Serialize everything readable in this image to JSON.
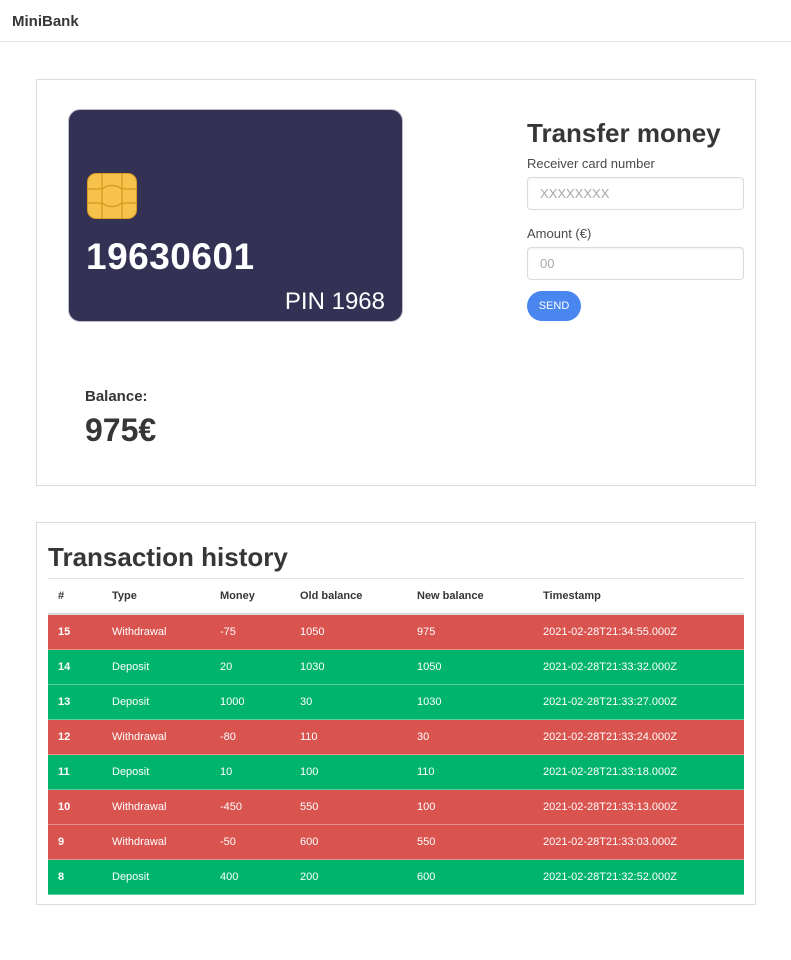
{
  "nav": {
    "brand": "MiniBank"
  },
  "card": {
    "number": "19630601",
    "pin": "PIN 1968",
    "chip_icon": "chip-icon",
    "background": "#333154"
  },
  "balance": {
    "label": "Balance:",
    "value": "975€"
  },
  "transfer": {
    "title": "Transfer money",
    "receiver_label": "Receiver card number",
    "receiver_placeholder": "XXXXXXXX",
    "amount_label": "Amount (€)",
    "amount_placeholder": "00",
    "send_label": "SEND",
    "button_color": "#4a86f0"
  },
  "history": {
    "title": "Transaction history",
    "columns": [
      "#",
      "Type",
      "Money",
      "Old balance",
      "New balance",
      "Timestamp"
    ],
    "colors": {
      "withdrawal": "#d9534f",
      "deposit": "#00b46c"
    },
    "rows": [
      {
        "id": "15",
        "type": "Withdrawal",
        "money": "-75",
        "old_balance": "1050",
        "new_balance": "975",
        "timestamp": "2021-02-28T21:34:55.000Z"
      },
      {
        "id": "14",
        "type": "Deposit",
        "money": "20",
        "old_balance": "1030",
        "new_balance": "1050",
        "timestamp": "2021-02-28T21:33:32.000Z"
      },
      {
        "id": "13",
        "type": "Deposit",
        "money": "1000",
        "old_balance": "30",
        "new_balance": "1030",
        "timestamp": "2021-02-28T21:33:27.000Z"
      },
      {
        "id": "12",
        "type": "Withdrawal",
        "money": "-80",
        "old_balance": "110",
        "new_balance": "30",
        "timestamp": "2021-02-28T21:33:24.000Z"
      },
      {
        "id": "11",
        "type": "Deposit",
        "money": "10",
        "old_balance": "100",
        "new_balance": "110",
        "timestamp": "2021-02-28T21:33:18.000Z"
      },
      {
        "id": "10",
        "type": "Withdrawal",
        "money": "-450",
        "old_balance": "550",
        "new_balance": "100",
        "timestamp": "2021-02-28T21:33:13.000Z"
      },
      {
        "id": "9",
        "type": "Withdrawal",
        "money": "-50",
        "old_balance": "600",
        "new_balance": "550",
        "timestamp": "2021-02-28T21:33:03.000Z"
      },
      {
        "id": "8",
        "type": "Deposit",
        "money": "400",
        "old_balance": "200",
        "new_balance": "600",
        "timestamp": "2021-02-28T21:32:52.000Z"
      }
    ]
  }
}
